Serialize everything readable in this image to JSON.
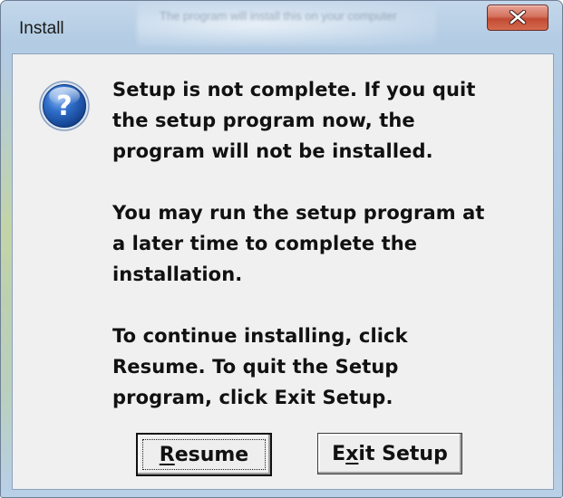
{
  "window": {
    "title": "Install",
    "background_text": "The program will install this on your computer"
  },
  "dialog": {
    "icon": "question-icon",
    "paragraphs": [
      "Setup is not complete.  If you quit\nthe setup program now, the\nprogram will not be installed.",
      "You may run the setup program at\na later time to complete the\ninstallation.",
      "To continue installing, click\nResume.  To quit the Setup\nprogram, click Exit Setup."
    ]
  },
  "buttons": {
    "resume_label": "Resume",
    "exit_label": "Exit Setup"
  },
  "colors": {
    "close_button": "#c24b33",
    "icon_blue": "#1f5fb8",
    "dialog_face": "#f0f0f0"
  }
}
